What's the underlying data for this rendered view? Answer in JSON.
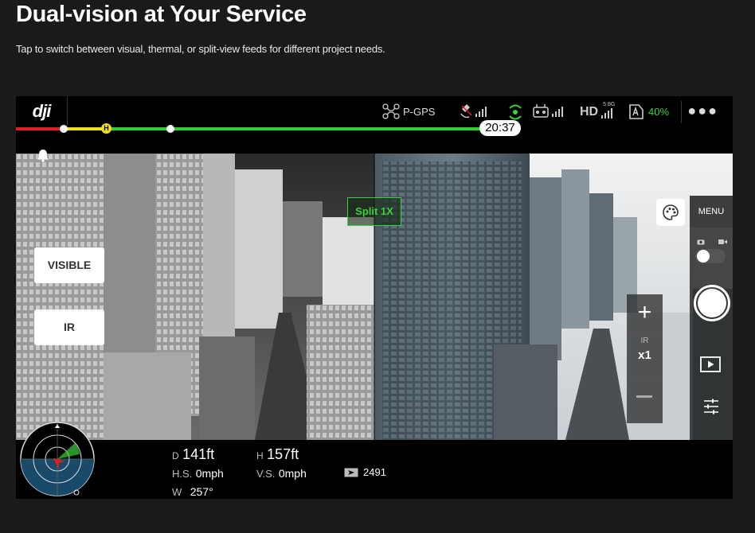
{
  "page": {
    "title": "Dual-vision at Your Service",
    "subtitle": "Tap to switch between visual, thermal, or split-view feeds for different project needs."
  },
  "topbar": {
    "logo": "dji",
    "gps_mode": "P-GPS",
    "hd_label": "HD",
    "hd_band": "5.8G",
    "battery_pct": "40%",
    "more_icon": "more-dots-icon"
  },
  "flight": {
    "timer": "20:37",
    "home_marker": "H",
    "progress_fraction": 0.667
  },
  "camera": {
    "mode_badge": "Split 1X",
    "visible_button": "VISIBLE",
    "ir_button": "IR",
    "zoom_plus": "+",
    "zoom_source": "IR",
    "zoom_level": "x1",
    "menu_label": "MENU"
  },
  "telemetry": {
    "d_prefix": "D",
    "distance": "141ft",
    "h_prefix": "H",
    "height": "157ft",
    "hs_label": "H.S.",
    "hs_value": "0mph",
    "vs_label": "V.S.",
    "vs_value": "0mph",
    "w_label": "W",
    "w_value": "257°",
    "count": "2491"
  },
  "colors": {
    "accent_green": "#3bd13b",
    "progress_red": "#e02020",
    "progress_yellow": "#f0e020"
  }
}
